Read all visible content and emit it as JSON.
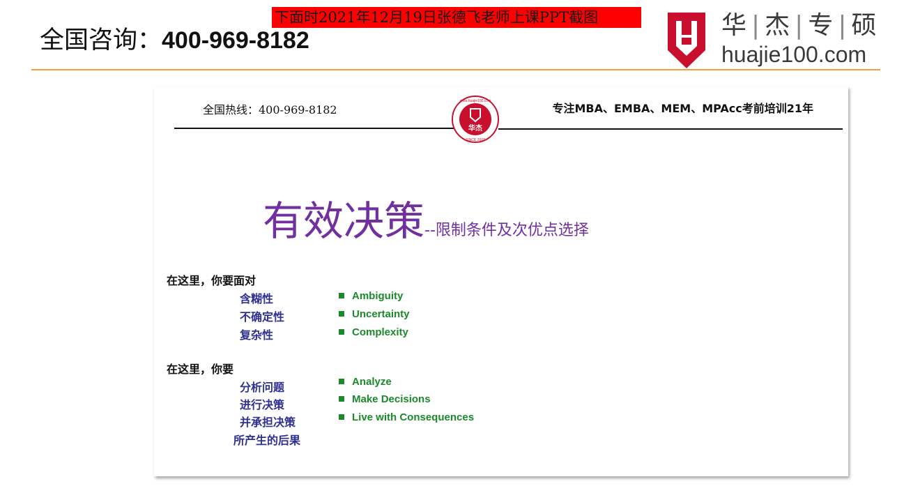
{
  "header": {
    "consult_label": "全国咨询：",
    "consult_phone": "400-969-8182",
    "red_banner": "下面时2021年12月19日张德飞老师上课PPT截图",
    "brand": {
      "cn_chars": [
        "华",
        "杰",
        "专",
        "硕"
      ],
      "separator": "|",
      "domain": "huajie100.com",
      "logo_color": "#c8102e"
    },
    "rule_color": "#f0a040"
  },
  "slide": {
    "hotline": "全国热线：400-969-8182",
    "focus": "专注MBA、EMBA、MEM、MPAcc考前培训21年",
    "seal": {
      "center_text": "华杰",
      "ring_top": "www.huajie100.com",
      "ring_bottom": "SINCE 2002"
    },
    "title_main": "有效决策",
    "title_sub": "--限制条件及次优点选择",
    "title_color": "#7030a0",
    "section1": {
      "heading": "在这里，你要面对",
      "cn_items": [
        "含糊性",
        "不确定性",
        "复杂性"
      ],
      "en_items": [
        "Ambiguity",
        "Uncertainty",
        "Complexity"
      ]
    },
    "section2": {
      "heading": "在这里，你要",
      "cn_items": [
        "分析问题",
        "进行决策",
        "并承担决策",
        "所产生的后果"
      ],
      "en_items": [
        "Analyze",
        "Make Decisions",
        "Live with Consequences"
      ]
    },
    "colors": {
      "cn_items": "#2e3192",
      "en_items": "#1a8a2a"
    }
  }
}
